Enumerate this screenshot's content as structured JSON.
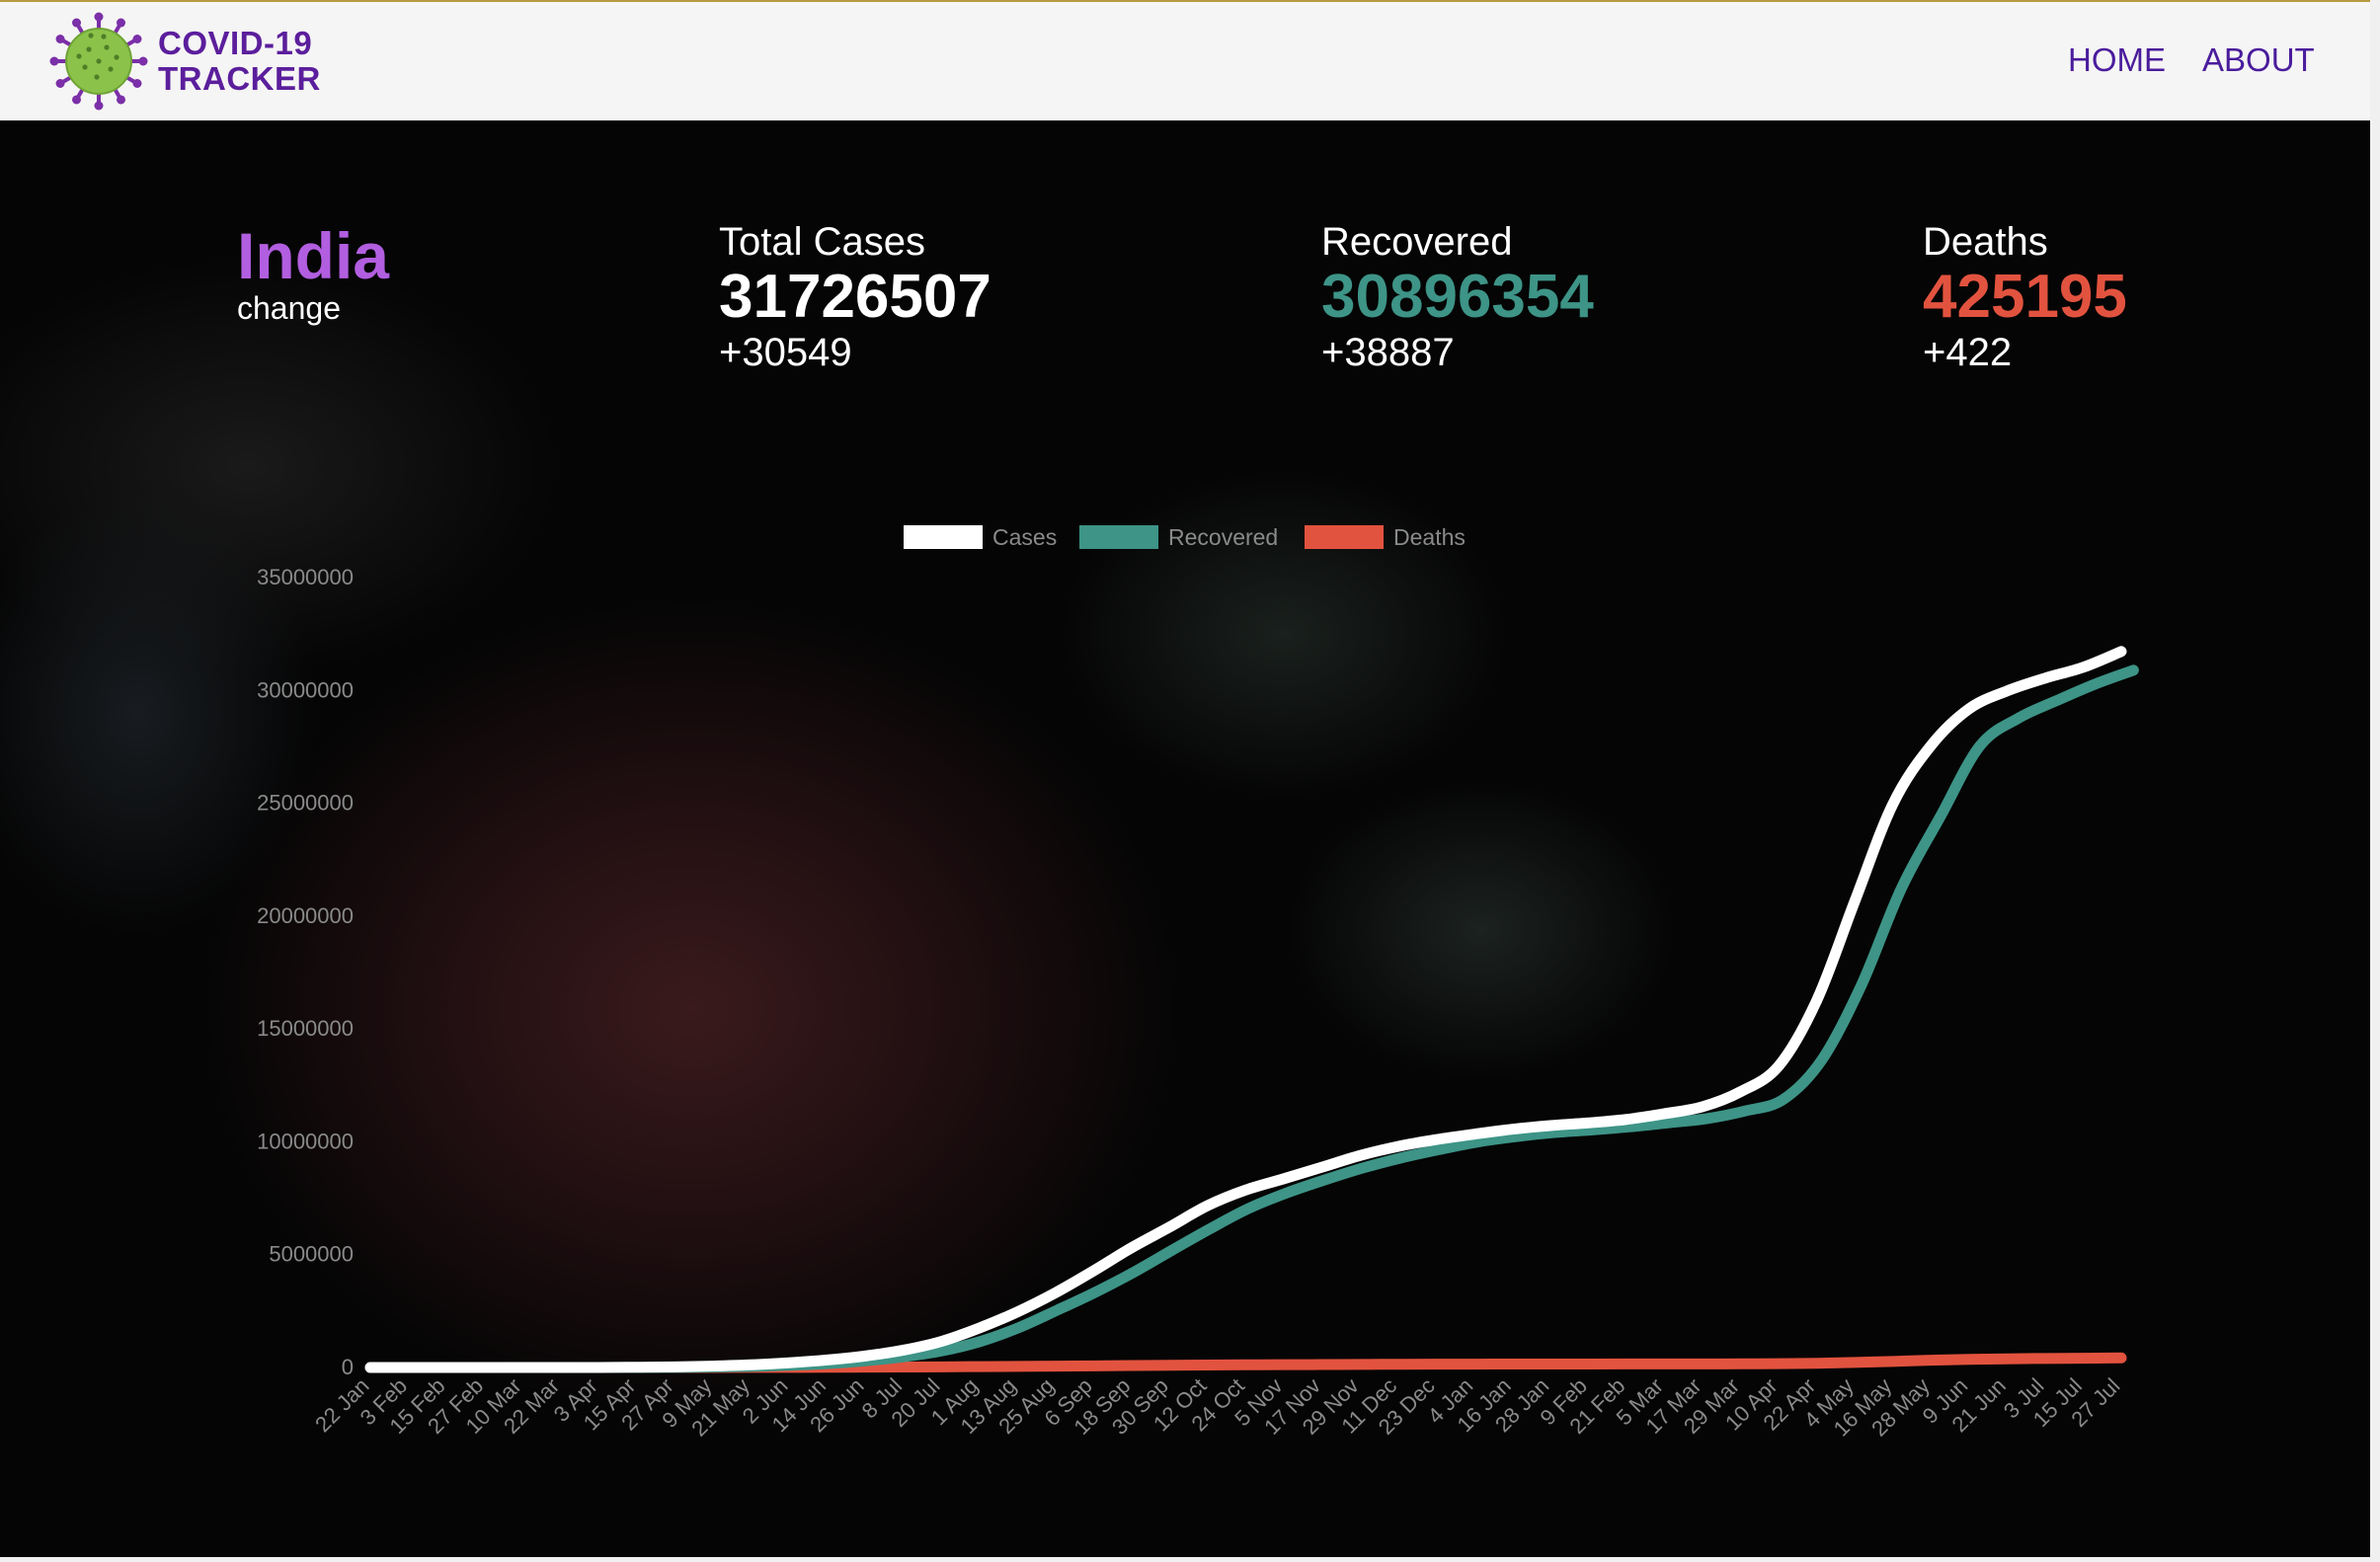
{
  "header": {
    "brand_line1": "COVID-19",
    "brand_line2": "TRACKER",
    "nav": [
      "HOME",
      "ABOUT"
    ],
    "logo_icon": "virus-icon",
    "colors": {
      "brand": "#5b1e9c",
      "virus_body": "#8bc34a",
      "virus_spikes": "#7b2fa8"
    }
  },
  "summary": {
    "country": "India",
    "change_label": "change",
    "total": {
      "label": "Total Cases",
      "value": "31726507",
      "delta": "+30549",
      "color": "#ffffff"
    },
    "recovered": {
      "label": "Recovered",
      "value": "30896354",
      "delta": "+38887",
      "color": "#3d9487"
    },
    "deaths": {
      "label": "Deaths",
      "value": "425195",
      "delta": "+422",
      "color": "#e2533f"
    },
    "country_color": "#b25ee0"
  },
  "chart_data": {
    "type": "line",
    "title": "",
    "xlabel": "",
    "ylabel": "",
    "legend_position": "top-center",
    "grid": false,
    "ylim": [
      0,
      35000000
    ],
    "yticks": [
      0,
      5000000,
      10000000,
      15000000,
      20000000,
      25000000,
      30000000,
      35000000
    ],
    "categories": [
      "22 Jan",
      "3 Feb",
      "15 Feb",
      "27 Feb",
      "10 Mar",
      "22 Mar",
      "3 Apr",
      "15 Apr",
      "27 Apr",
      "9 May",
      "21 May",
      "2 Jun",
      "14 Jun",
      "26 Jun",
      "8 Jul",
      "20 Jul",
      "1 Aug",
      "13 Aug",
      "25 Aug",
      "6 Sep",
      "18 Sep",
      "30 Sep",
      "12 Oct",
      "24 Oct",
      "5 Nov",
      "17 Nov",
      "29 Nov",
      "11 Dec",
      "23 Dec",
      "4 Jan",
      "16 Jan",
      "28 Jan",
      "9 Feb",
      "21 Feb",
      "5 Mar",
      "17 Mar",
      "29 Mar",
      "10 Apr",
      "22 Apr",
      "4 May",
      "16 May",
      "28 May",
      "9 Jun",
      "21 Jun",
      "3 Jul",
      "15 Jul",
      "27 Jul"
    ],
    "series": [
      {
        "name": "Cases",
        "color": "#ffffff",
        "values": [
          0,
          0,
          3,
          3,
          62,
          396,
          2547,
          12370,
          29451,
          62939,
          118447,
          207615,
          332424,
          508953,
          767296,
          1155191,
          1750723,
          2461190,
          3310234,
          4280422,
          5308014,
          6225763,
          7175880,
          7864811,
          8364086,
          8874290,
          9392919,
          9796769,
          10099066,
          10340469,
          10557985,
          10720048,
          10838194,
          10991651,
          11244786,
          11555284,
          12221665,
          13358805,
          16263695,
          20665148,
          24965463,
          27555457,
          29183121,
          29977861,
          30545433,
          31026829,
          31726507
        ]
      },
      {
        "name": "Recovered",
        "color": "#3d9487",
        "values": [
          0,
          0,
          0,
          3,
          4,
          23,
          162,
          1489,
          7026,
          19301,
          48534,
          100303,
          169798,
          295881,
          476378,
          732835,
          1145629,
          1751555,
          2523771,
          3323950,
          4208431,
          5187825,
          6149535,
          7046003,
          7737539,
          8316832,
          8847600,
          9290834,
          9661658,
          9994800,
          10229410,
          10410092,
          10525330,
          10667741,
          10845424,
          11028640,
          11367542,
          11882071,
          13648159,
          16951731,
          21219030,
          24430787,
          27541470,
          28770008,
          29552109,
          30281747,
          30896354
        ]
      },
      {
        "name": "Deaths",
        "color": "#e2533f",
        "values": [
          0,
          0,
          0,
          0,
          2,
          7,
          75,
          405,
          934,
          2109,
          3584,
          5829,
          9520,
          15685,
          21604,
          28732,
          38135,
          48040,
          58390,
          71642,
          85619,
          98678,
          110586,
          118534,
          124315,
          129635,
          137139,
          142628,
          146756,
          149435,
          152274,
          154147,
          155399,
          156385,
          157853,
          159558,
          161586,
          168436,
          187689,
          226188,
          270284,
          322385,
          359676,
          385137,
          400312,
          411989,
          425195
        ]
      }
    ]
  }
}
